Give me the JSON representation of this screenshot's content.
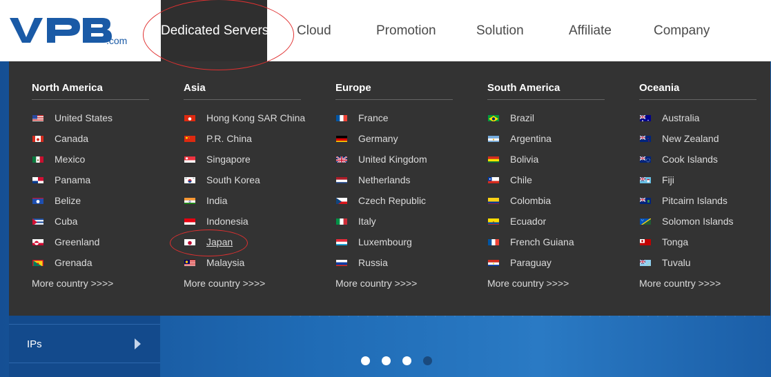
{
  "logo": {
    "brand": "VPB",
    "suffix": ".com"
  },
  "nav": [
    {
      "label": "Dedicated Servers",
      "active": true
    },
    {
      "label": "Cloud"
    },
    {
      "label": "Promotion"
    },
    {
      "label": "Solution"
    },
    {
      "label": "Affiliate"
    },
    {
      "label": "Company"
    }
  ],
  "regions": [
    {
      "title": "North America",
      "countries": [
        "United States",
        "Canada",
        "Mexico",
        "Panama",
        "Belize",
        "Cuba",
        "Greenland",
        "Grenada"
      ],
      "more": "More country >>>>"
    },
    {
      "title": "Asia",
      "countries": [
        "Hong Kong SAR China",
        "P.R. China",
        "Singapore",
        "South Korea",
        "India",
        "Indonesia",
        "Japan",
        "Malaysia"
      ],
      "more": "More country >>>>"
    },
    {
      "title": "Europe",
      "countries": [
        "France",
        "Germany",
        "United Kingdom",
        "Netherlands",
        "Czech Republic",
        "Italy",
        "Luxembourg",
        "Russia"
      ],
      "more": "More country >>>>"
    },
    {
      "title": "South America",
      "countries": [
        "Brazil",
        "Argentina",
        "Bolivia",
        "Chile",
        "Colombia",
        "Ecuador",
        "French Guiana",
        "Paraguay"
      ],
      "more": "More country >>>>"
    },
    {
      "title": "Oceania",
      "countries": [
        "Australia",
        "New Zealand",
        "Cook Islands",
        "Fiji",
        "Pitcairn Islands",
        "Solomon Islands",
        "Tonga",
        "Tuvalu"
      ],
      "more": "More country >>>>"
    }
  ],
  "sidemenu": {
    "ips_label": "IPs"
  },
  "carousel": {
    "count": 4,
    "active_index": 3
  },
  "colors": {
    "accent_red": "#e03030",
    "dropdown_bg": "#333333",
    "nav_active_bg": "#2f2f2f",
    "logo_blue": "#1a5aa6"
  }
}
